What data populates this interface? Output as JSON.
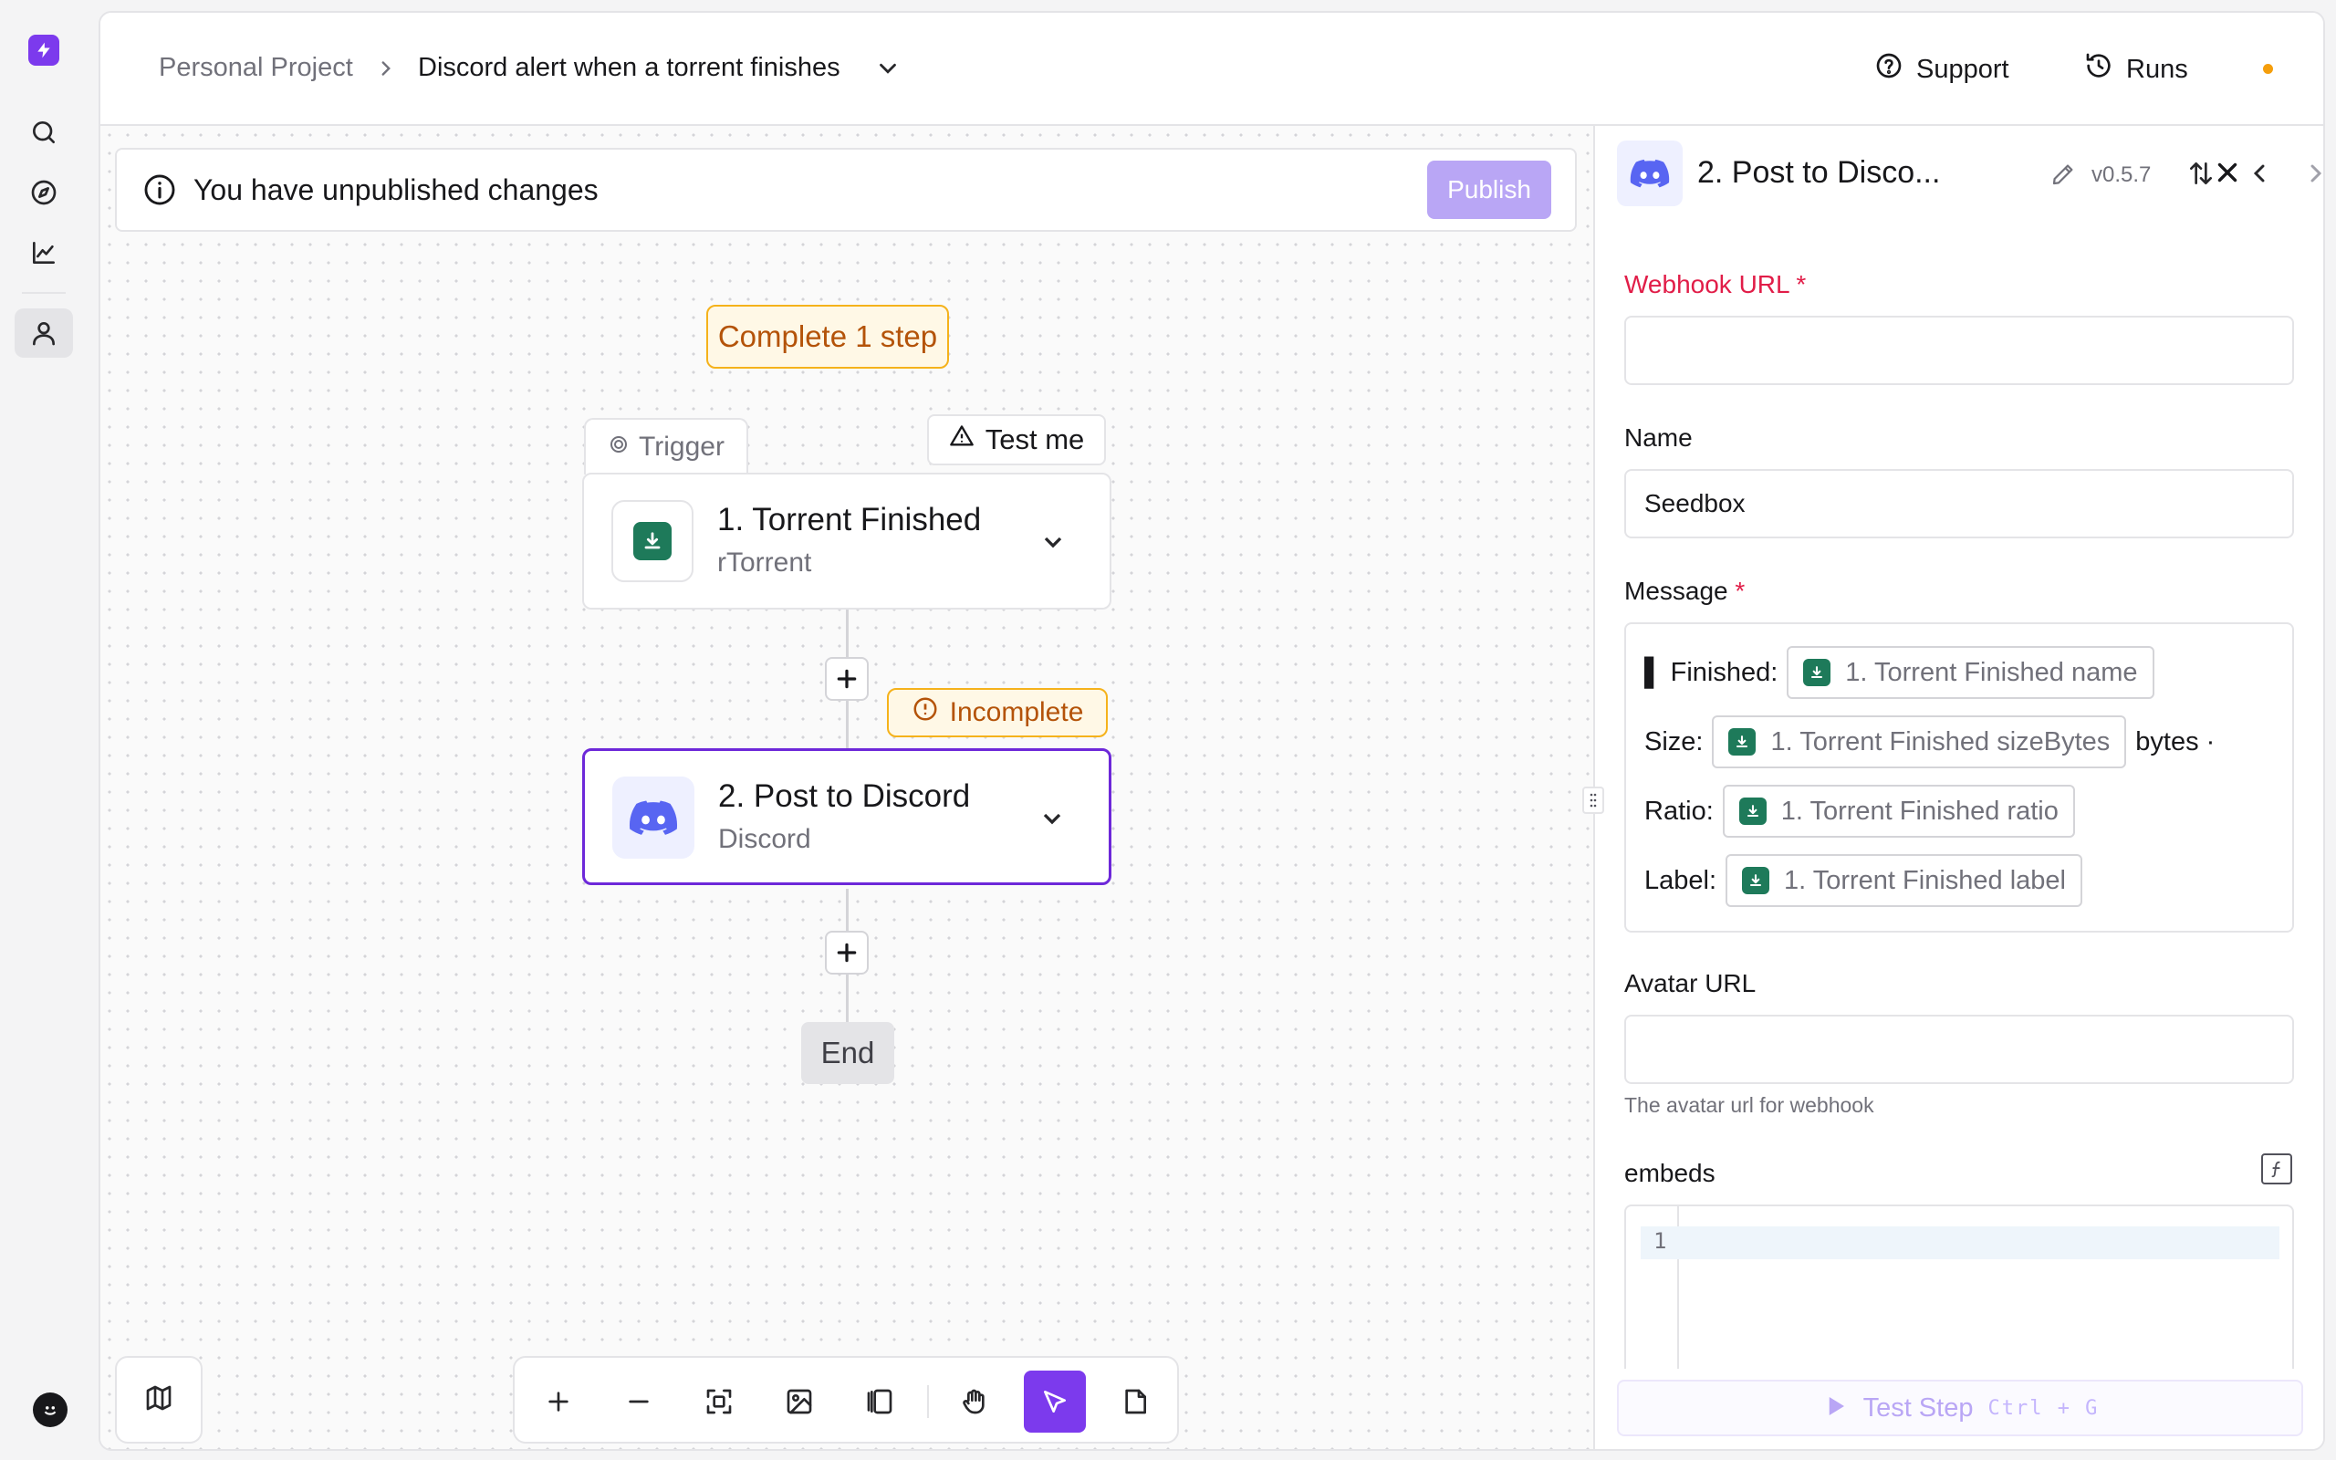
{
  "header": {
    "project": "Personal Project",
    "flow_name": "Discord alert when a torrent finishes",
    "support_label": "Support",
    "runs_label": "Runs"
  },
  "canvas": {
    "banner_text": "You have unpublished changes",
    "publish_label": "Publish",
    "complete_badge": "Complete 1 step",
    "trigger_tab": "Trigger",
    "test_me": "Test me",
    "incomplete_badge": "Incomplete",
    "end_label": "End",
    "steps": [
      {
        "title": "1. Torrent Finished",
        "subtitle": "rTorrent"
      },
      {
        "title": "2. Post to Discord",
        "subtitle": "Discord"
      }
    ]
  },
  "panel": {
    "title": "2. Post to Disco...",
    "version": "v0.5.7",
    "webhook_label": "Webhook URL",
    "name_label": "Name",
    "name_value": "Seedbox",
    "message_label": "Message",
    "required_mark": "*",
    "message_rows": [
      {
        "prefix": "▌ Finished:",
        "chip": "1. Torrent Finished name",
        "suffix": ""
      },
      {
        "prefix": "Size:",
        "chip": "1. Torrent Finished sizeBytes",
        "suffix": "bytes ·"
      },
      {
        "prefix": "Ratio:",
        "chip": "1. Torrent Finished ratio",
        "suffix": ""
      },
      {
        "prefix": "Label:",
        "chip": "1. Torrent Finished label",
        "suffix": ""
      }
    ],
    "avatar_label": "Avatar URL",
    "avatar_help": "The avatar url for webhook",
    "embeds_label": "embeds",
    "code_line_number": "1",
    "test_step_label": "Test Step",
    "test_step_shortcut": "Ctrl + G"
  },
  "colors": {
    "brand": "#7c3aed",
    "discord": "#5865f2",
    "rtorrent": "#1e7a5a",
    "warning": "#f5b21b",
    "required": "#e11d48"
  },
  "icons": {
    "rail": [
      "logo-icon",
      "search-icon",
      "compass-icon",
      "chart-icon",
      "user-icon",
      "avatar-icon"
    ],
    "toolbar": [
      "zoom-in-icon",
      "zoom-out-icon",
      "fit-view-icon",
      "image-icon",
      "panel-icon",
      "hand-icon",
      "pointer-icon",
      "note-icon"
    ]
  }
}
